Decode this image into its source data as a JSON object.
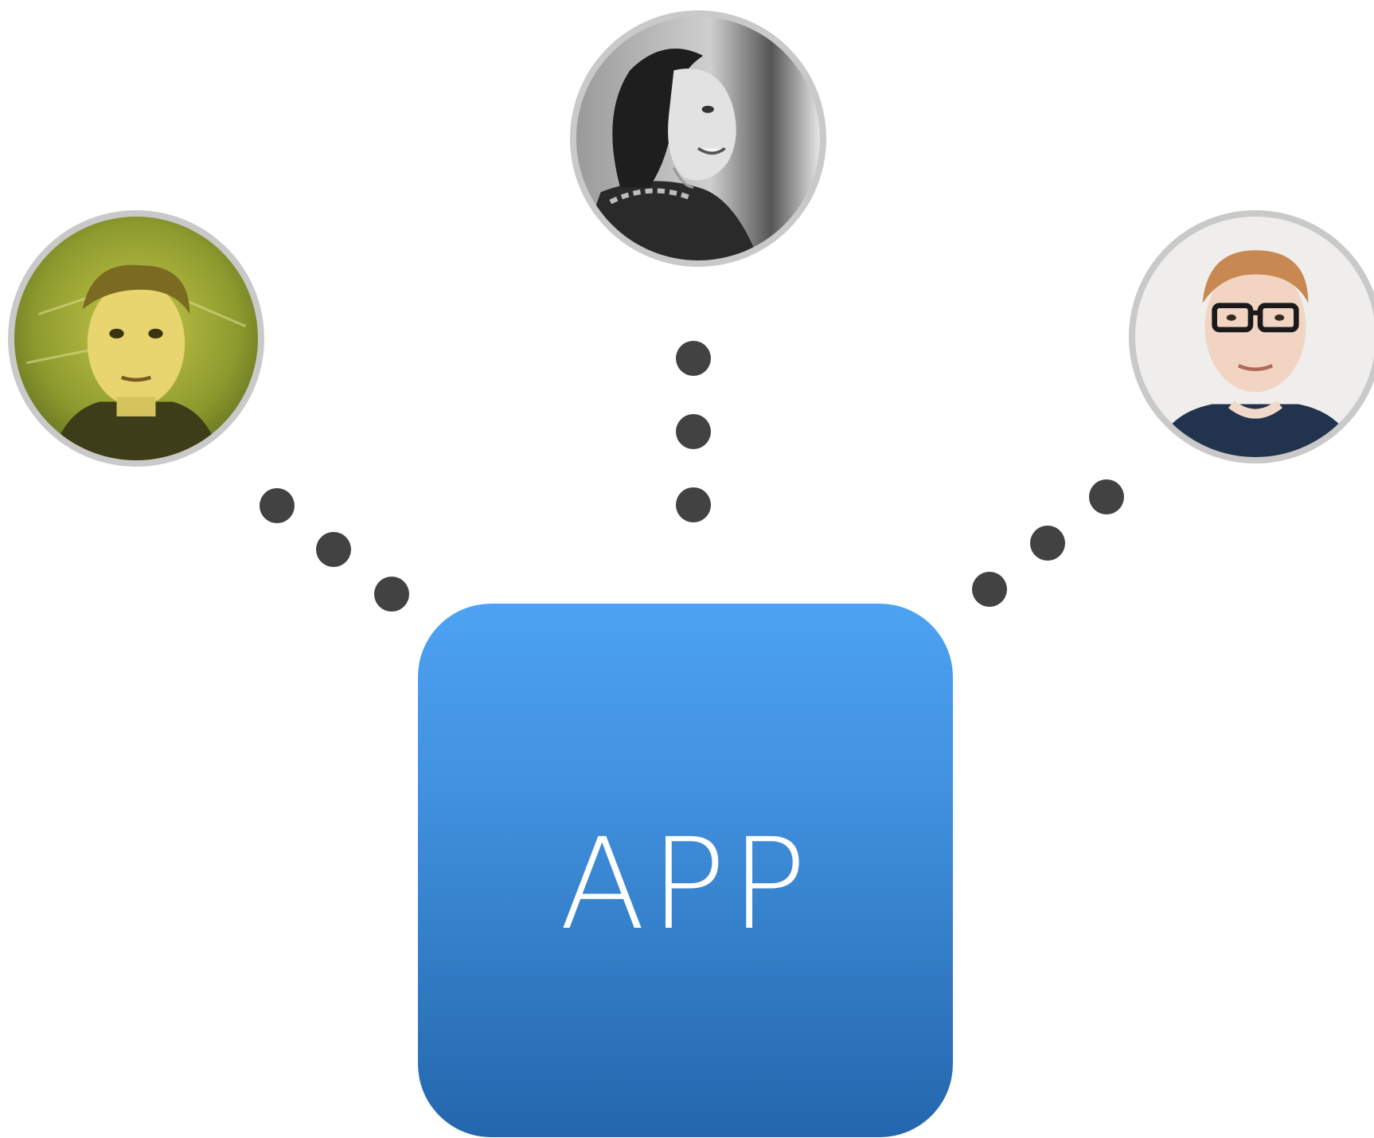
{
  "app_tile": {
    "label": "APP",
    "gradient_top": "#4da2f2",
    "gradient_bottom": "#2466ad"
  },
  "connector": {
    "dot_color": "#424242"
  },
  "avatars": [
    {
      "name": "avatar-left",
      "depicts": "man-portrait-yellow-tint"
    },
    {
      "name": "avatar-center",
      "depicts": "woman-portrait-grayscale"
    },
    {
      "name": "avatar-right",
      "depicts": "man-with-glasses-portrait"
    }
  ],
  "avatar_ring_color": "#c9c9c9"
}
